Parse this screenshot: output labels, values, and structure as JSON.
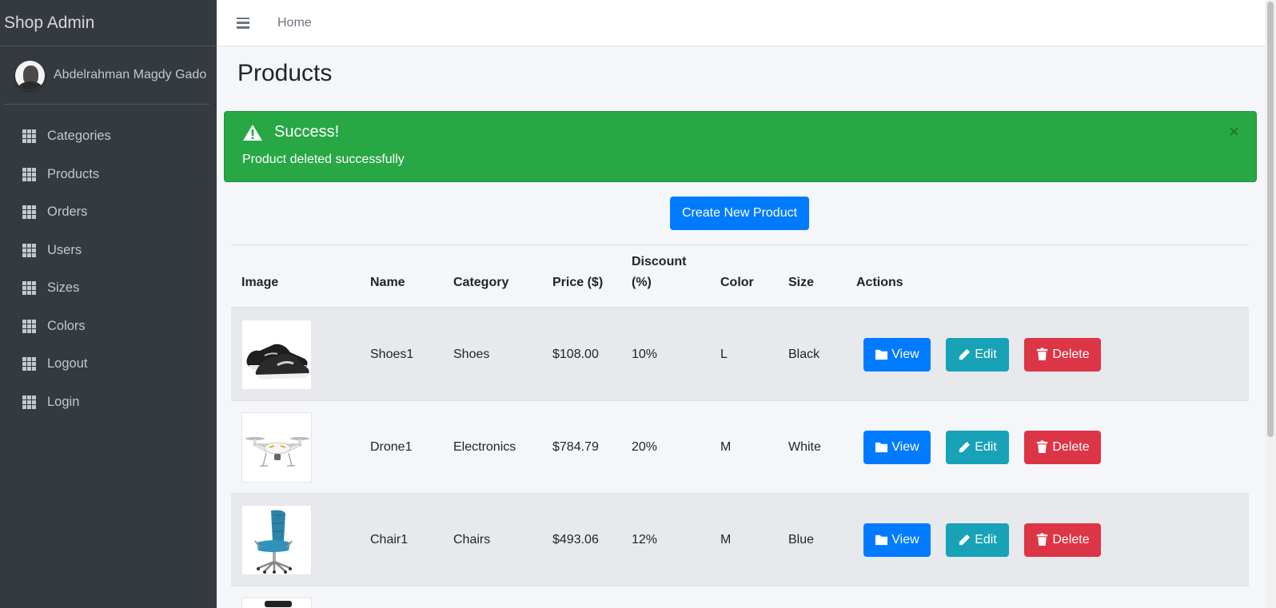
{
  "brand": "Shop Admin",
  "user": {
    "name": "Abdelrahman Magdy Gado"
  },
  "sidebar": {
    "items": [
      {
        "label": "Categories"
      },
      {
        "label": "Products"
      },
      {
        "label": "Orders"
      },
      {
        "label": "Users"
      },
      {
        "label": "Sizes"
      },
      {
        "label": "Colors"
      },
      {
        "label": "Logout"
      },
      {
        "label": "Login"
      }
    ]
  },
  "topbar": {
    "home": "Home"
  },
  "page": {
    "title": "Products"
  },
  "alert": {
    "title": "Success!",
    "message": "Product deleted successfully",
    "close": "×"
  },
  "buttons": {
    "create": "Create New Product",
    "view": "View",
    "edit": "Edit",
    "delete": "Delete"
  },
  "table": {
    "headers": {
      "image": "Image",
      "name": "Name",
      "category": "Category",
      "price": "Price ($)",
      "discount": "Discount (%)",
      "color": "Color",
      "size": "Size",
      "actions": "Actions"
    },
    "rows": [
      {
        "image": "shoe",
        "name": "Shoes1",
        "category": "Shoes",
        "price": "$108.00",
        "discount": "10%",
        "color": "L",
        "size": "Black"
      },
      {
        "image": "drone",
        "name": "Drone1",
        "category": "Electronics",
        "price": "$784.79",
        "discount": "20%",
        "color": "M",
        "size": "White"
      },
      {
        "image": "chair",
        "name": "Chair1",
        "category": "Chairs",
        "price": "$493.06",
        "discount": "12%",
        "color": "M",
        "size": "Blue"
      }
    ]
  },
  "colors": {
    "sidebar": "#343a40",
    "success": "#28a745",
    "primary": "#007bff",
    "info": "#17a2b8",
    "danger": "#dc3545"
  }
}
